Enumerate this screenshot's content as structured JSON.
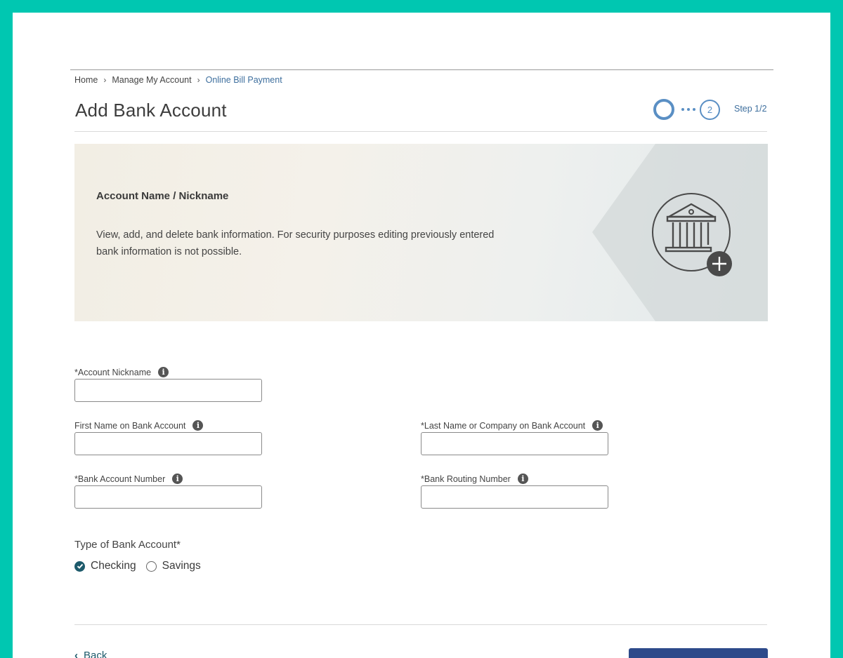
{
  "breadcrumb": {
    "items": [
      "Home",
      "Manage My Account"
    ],
    "current": "Online Bill Payment",
    "separator": "›"
  },
  "page": {
    "title": "Add Bank Account"
  },
  "stepper": {
    "next_step_number": "2",
    "label": "Step 1/2",
    "accent_color": "#5a8fc4"
  },
  "banner": {
    "heading": "Account Name / Nickname",
    "text": "View, add, and delete bank information. For security purposes editing previously entered bank information is not possible.",
    "icon": "bank-add-icon"
  },
  "form": {
    "nickname": {
      "label": "*Account Nickname",
      "value": ""
    },
    "first_name": {
      "label": "First Name on Bank Account",
      "value": ""
    },
    "last_name": {
      "label": "*Last Name or Company on Bank Account",
      "value": ""
    },
    "account_number": {
      "label": "*Bank Account Number",
      "value": ""
    },
    "routing_number": {
      "label": "*Bank Routing Number",
      "value": ""
    },
    "account_type": {
      "label": "Type of Bank Account*",
      "options": [
        "Checking",
        "Savings"
      ],
      "selected": "Checking"
    }
  },
  "footer": {
    "back_label": "Back",
    "next_label": ""
  },
  "colors": {
    "frame": "#00c7b1",
    "primary_button": "#2d4a8a",
    "link": "#3e6f9e",
    "radio_checked": "#1d5a6b"
  }
}
